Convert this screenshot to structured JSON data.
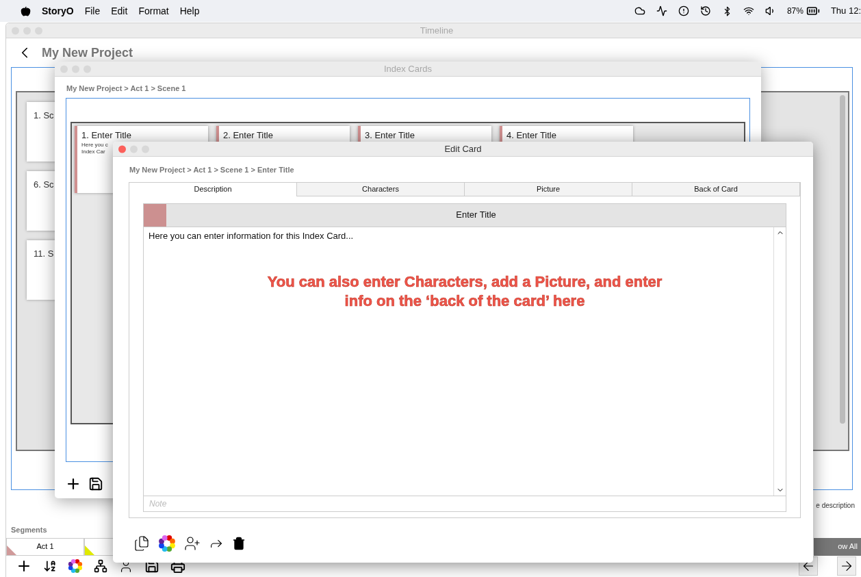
{
  "menu_bar": {
    "app_name": "StoryO",
    "menus": [
      "File",
      "Edit",
      "Format",
      "Help"
    ],
    "battery": "87%",
    "clock": "Thu 12:"
  },
  "timeline_window": {
    "title": "Timeline",
    "project_title": "My New Project",
    "cards": [
      "1. Sc",
      "6. Sc",
      "11. S"
    ],
    "description_label": "e description",
    "segments_label": "Segments",
    "segments": [
      {
        "label": "Act 1",
        "color": "#d09a9a"
      },
      {
        "color": "#e0ea00"
      }
    ],
    "show_all_button": "ow All"
  },
  "index_cards_window": {
    "title": "Index Cards",
    "breadcrumb": "My New Project > Act 1 > Scene 1",
    "cards": [
      {
        "title": "1. Enter Title",
        "description_lines": [
          "Here you c",
          "Index Car"
        ]
      },
      {
        "title": "2. Enter Title"
      },
      {
        "title": "3. Enter Title"
      },
      {
        "title": "4. Enter Title"
      }
    ]
  },
  "edit_card_window": {
    "title": "Edit Card",
    "breadcrumb": "My New Project > Act 1 > Scene 1 > Enter Title",
    "tabs": [
      {
        "label": "Description",
        "selected": true
      },
      {
        "label": "Characters",
        "selected": false
      },
      {
        "label": "Picture",
        "selected": false
      },
      {
        "label": "Back of Card",
        "selected": false
      }
    ],
    "card_title": "Enter Title",
    "body": "Here you can enter information for this Index Card...",
    "note_placeholder": "Note"
  },
  "annotation": "You can also enter Characters, add a Picture, and enter info on the ‘back of the card’ here"
}
